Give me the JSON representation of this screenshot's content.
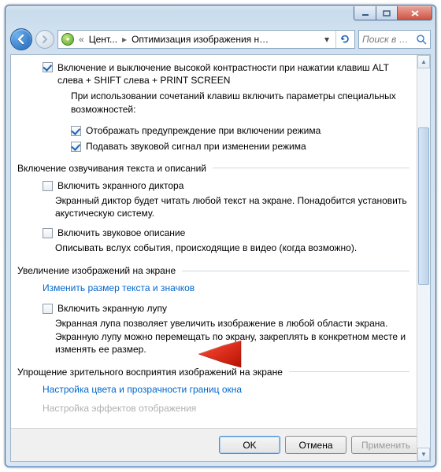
{
  "titlebar": {},
  "nav": {
    "crumb1": "Цент...",
    "crumb2": "Оптимизация изображения на э...",
    "search_placeholder": "Поиск в па..."
  },
  "s1": {
    "chk_highcontrast": "Включение и выключение высокой контрастности при нажатии клавиш ALT слева + SHIFT слева + PRINT SCREEN",
    "sub_intro": "При использовании сочетаний клавиш включить параметры специальных возможностей:",
    "chk_warning": "Отображать предупреждение при включении режима",
    "chk_sound": "Подавать звуковой сигнал при изменении режима"
  },
  "s2": {
    "title": "Включение озвучивания текста и описаний",
    "chk_narrator": "Включить экранного диктора",
    "narrator_desc": "Экранный диктор будет читать любой текст на экране. Понадобится установить акустическую систему.",
    "chk_audiodesc": "Включить звуковое описание",
    "audiodesc_desc": "Описывать вслух события, происходящие в видео (когда возможно)."
  },
  "s3": {
    "title": "Увеличение изображений на экране",
    "link_textsize": "Изменить размер текста и значков",
    "chk_magnifier": "Включить экранную лупу",
    "magnifier_desc": "Экранная лупа позволяет увеличить изображение в любой области экрана. Экранную лупу можно перемещать по экрану, закреплять в конкретном месте и изменять ее размер."
  },
  "s4": {
    "title": "Упрощение зрительного восприятия изображений на экране",
    "link_color": "Настройка цвета и прозрачности границ окна",
    "link_effects_cut": "Настройка эффектов отображения"
  },
  "buttons": {
    "ok": "OK",
    "cancel": "Отмена",
    "apply": "Применить"
  }
}
